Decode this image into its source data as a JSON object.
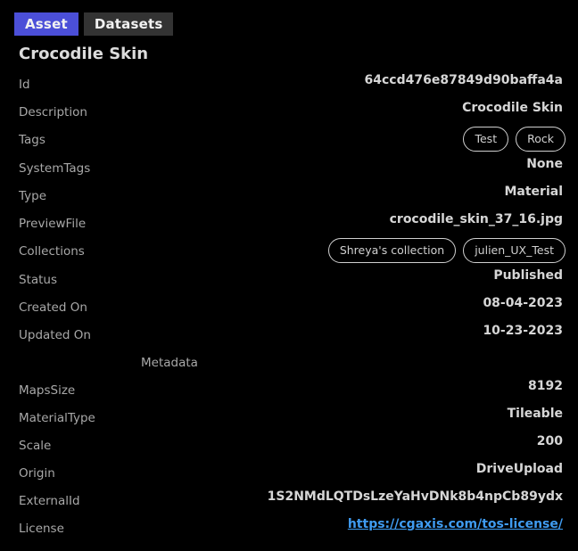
{
  "tabs": [
    {
      "label": "Asset",
      "active": true
    },
    {
      "label": "Datasets",
      "active": false
    }
  ],
  "title": "Crocodile Skin",
  "fields": {
    "id": {
      "label": "Id",
      "value": "64ccd476e87849d90baffa4a"
    },
    "description": {
      "label": "Description",
      "value": "Crocodile Skin"
    },
    "tags": {
      "label": "Tags",
      "chips": [
        "Test",
        "Rock"
      ]
    },
    "system_tags": {
      "label": "SystemTags",
      "value": "None"
    },
    "type": {
      "label": "Type",
      "value": "Material"
    },
    "preview_file": {
      "label": "PreviewFile",
      "value": "crocodile_skin_37_16.jpg"
    },
    "collections": {
      "label": "Collections",
      "chips": [
        "Shreya's collection",
        "julien_UX_Test"
      ]
    },
    "status": {
      "label": "Status",
      "value": "Published"
    },
    "created_on": {
      "label": "Created On",
      "value": "08-04-2023"
    },
    "updated_on": {
      "label": "Updated On",
      "value": "10-23-2023"
    }
  },
  "metadata": {
    "heading": "Metadata",
    "maps_size": {
      "label": "MapsSize",
      "value": "8192"
    },
    "material_type": {
      "label": "MaterialType",
      "value": "Tileable"
    },
    "scale": {
      "label": "Scale",
      "value": "200"
    },
    "origin": {
      "label": "Origin",
      "value": "DriveUpload"
    },
    "external_id": {
      "label": "ExternalId",
      "value": "1S2NMdLQTDsLzeYaHvDNk8b4npCb89ydx"
    },
    "license": {
      "label": "License",
      "value": "https://cgaxis.com/tos-license/"
    }
  },
  "colors": {
    "accent": "#4b4fd8",
    "tab_inactive": "#333333",
    "link": "#3f9bf0",
    "background": "#000000"
  }
}
